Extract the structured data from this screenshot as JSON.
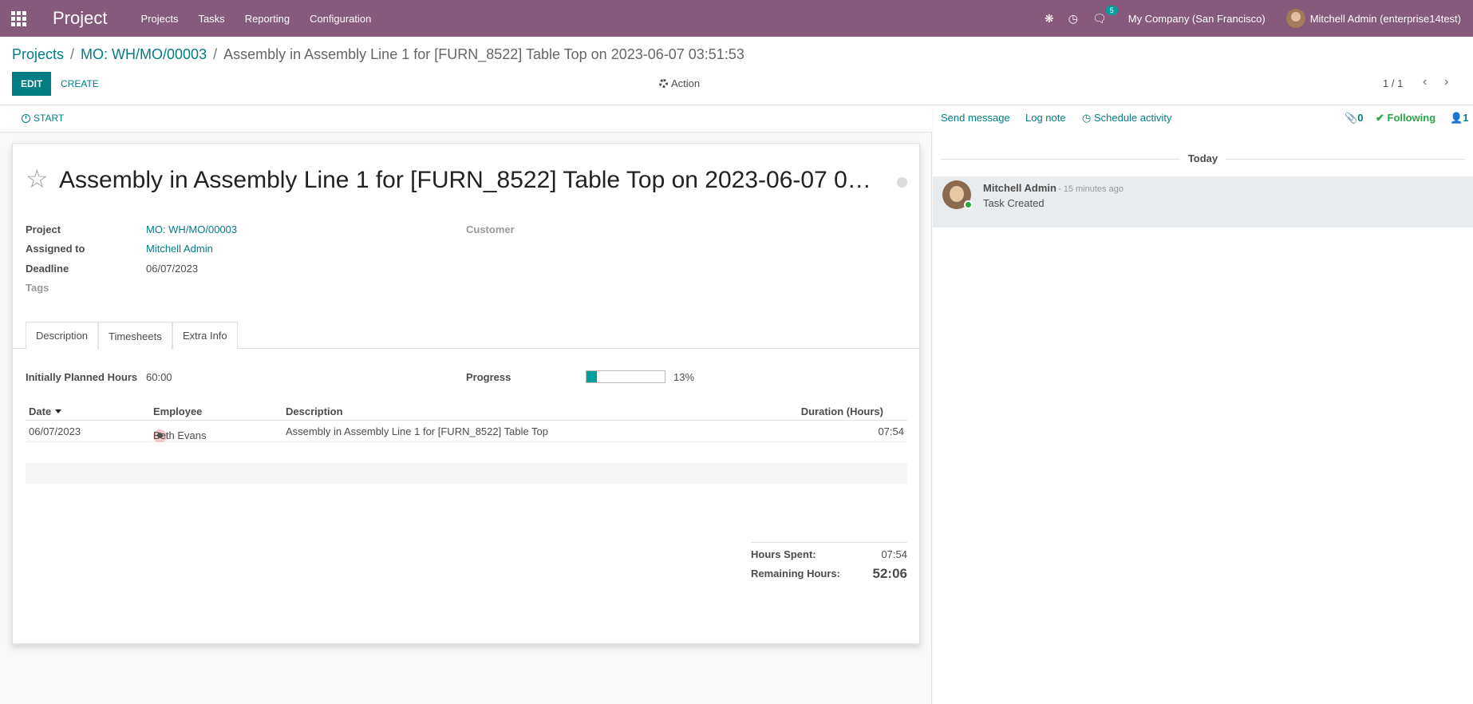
{
  "navbar": {
    "app_name": "Project",
    "menus": [
      "Projects",
      "Tasks",
      "Reporting",
      "Configuration"
    ],
    "messages_badge": "5",
    "company": "My Company (San Francisco)",
    "user": "Mitchell Admin (enterprise14test)",
    "icons": [
      "apps-grid-icon",
      "bug-icon",
      "clock-icon",
      "chat-icon"
    ],
    "color": "#875a7b"
  },
  "breadcrumb": {
    "items": [
      "Projects",
      "MO: WH/MO/00003"
    ],
    "current": "Assembly in Assembly Line 1 for [FURN_8522] Table Top on 2023-06-07 03:51:53"
  },
  "toolbar": {
    "edit_label": "EDIT",
    "create_label": "CREATE",
    "action_label": "Action",
    "pager": "1 / 1"
  },
  "statusbar": {
    "start_label": "START"
  },
  "form": {
    "title": "Assembly in Assembly Line 1 for [FURN_8522] Table Top on 2023-06-07 0…",
    "fields": {
      "project_label": "Project",
      "project_value": "MO: WH/MO/00003",
      "assigned_label": "Assigned to",
      "assigned_value": "Mitchell Admin",
      "deadline_label": "Deadline",
      "deadline_value": "06/07/2023",
      "tags_label": "Tags",
      "customer_label": "Customer"
    },
    "tabs": [
      {
        "label": "Description",
        "active": false
      },
      {
        "label": "Timesheets",
        "active": true
      },
      {
        "label": "Extra Info",
        "active": false
      }
    ],
    "planned_label": "Initially Planned Hours",
    "planned_value": "60:00",
    "progress_label": "Progress",
    "progress_percent": 13,
    "progress_text": "13%"
  },
  "timesheets": {
    "columns": [
      "Date",
      "Employee",
      "Description",
      "Duration (Hours)"
    ],
    "rows": [
      {
        "date": "06/07/2023",
        "employee": "Beth Evans",
        "description": "Assembly in Assembly Line 1 for [FURN_8522] Table Top",
        "duration": "07:54"
      }
    ],
    "hours_spent_label": "Hours Spent:",
    "hours_spent_value": "07:54",
    "remaining_label": "Remaining Hours:",
    "remaining_value": "52:06"
  },
  "chatter": {
    "send_message": "Send message",
    "log_note": "Log note",
    "schedule_activity": "Schedule activity",
    "attachments_count": "0",
    "following_label": "Following",
    "followers_count": "1",
    "date_separator": "Today",
    "messages": [
      {
        "author": "Mitchell Admin",
        "date": "- 15 minutes ago",
        "body": "Task Created"
      }
    ]
  },
  "colors": {
    "accent": "#017e84",
    "brand": "#875a7b",
    "following": "#28a745"
  }
}
